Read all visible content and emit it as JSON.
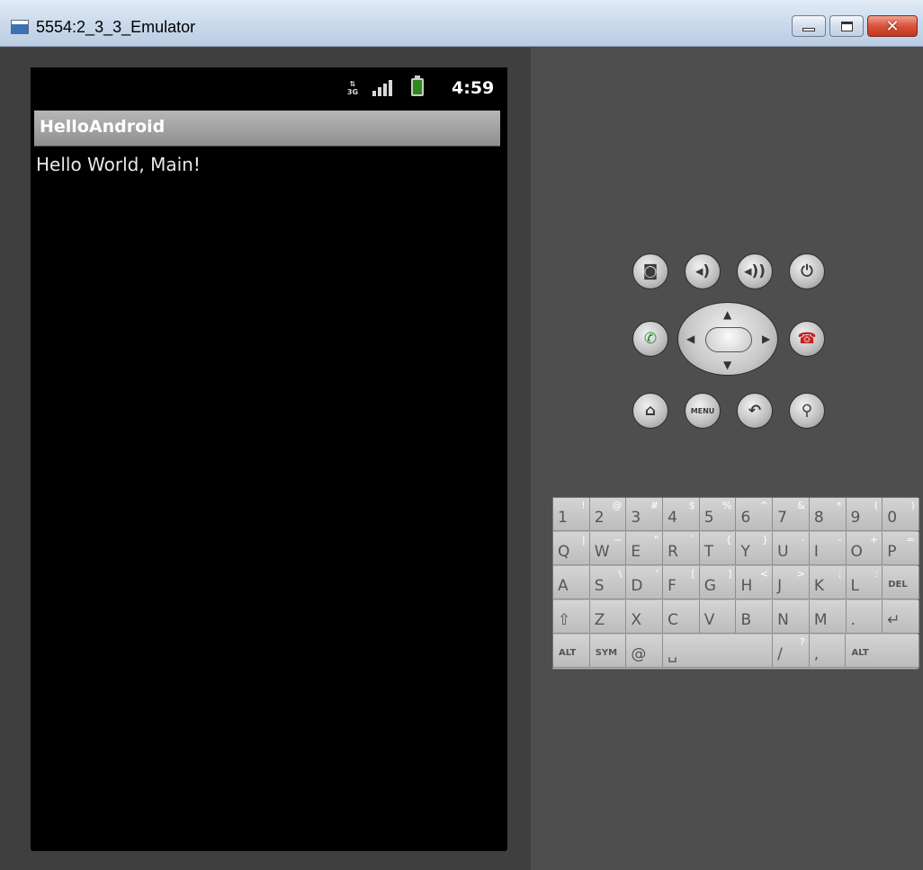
{
  "window": {
    "title": "5554:2_3_3_Emulator",
    "close_glyph": "✕"
  },
  "status_bar": {
    "network_label": "3G",
    "time": "4:59"
  },
  "app": {
    "title": "HelloAndroid",
    "message": "Hello World, Main!"
  },
  "controls": {
    "menu_label": "MENU"
  },
  "keyboard": {
    "row1": [
      {
        "main": "1",
        "alt": "!"
      },
      {
        "main": "2",
        "alt": "@"
      },
      {
        "main": "3",
        "alt": "#"
      },
      {
        "main": "4",
        "alt": "$"
      },
      {
        "main": "5",
        "alt": "%"
      },
      {
        "main": "6",
        "alt": "^"
      },
      {
        "main": "7",
        "alt": "&"
      },
      {
        "main": "8",
        "alt": "*"
      },
      {
        "main": "9",
        "alt": "("
      },
      {
        "main": "0",
        "alt": ")"
      }
    ],
    "row2": [
      {
        "main": "Q",
        "alt": "|"
      },
      {
        "main": "W",
        "alt": "~"
      },
      {
        "main": "E",
        "alt": "\""
      },
      {
        "main": "R",
        "alt": "`"
      },
      {
        "main": "T",
        "alt": "{"
      },
      {
        "main": "Y",
        "alt": "}"
      },
      {
        "main": "U",
        "alt": "-"
      },
      {
        "main": "I",
        "alt": "-"
      },
      {
        "main": "O",
        "alt": "+"
      },
      {
        "main": "P",
        "alt": "="
      }
    ],
    "row3": [
      {
        "main": "A",
        "alt": ""
      },
      {
        "main": "S",
        "alt": "\\"
      },
      {
        "main": "D",
        "alt": "'"
      },
      {
        "main": "F",
        "alt": "["
      },
      {
        "main": "G",
        "alt": "]"
      },
      {
        "main": "H",
        "alt": "<"
      },
      {
        "main": "J",
        "alt": ">"
      },
      {
        "main": "K",
        "alt": ";"
      },
      {
        "main": "L",
        "alt": ":"
      },
      {
        "main": "DEL",
        "alt": ""
      }
    ],
    "row4": [
      {
        "main": "⇧",
        "alt": ""
      },
      {
        "main": "Z",
        "alt": ""
      },
      {
        "main": "X",
        "alt": ""
      },
      {
        "main": "C",
        "alt": ""
      },
      {
        "main": "V",
        "alt": ""
      },
      {
        "main": "B",
        "alt": ""
      },
      {
        "main": "N",
        "alt": ""
      },
      {
        "main": "M",
        "alt": ""
      },
      {
        "main": ".",
        "alt": ""
      },
      {
        "main": "↵",
        "alt": ""
      }
    ],
    "row5": [
      {
        "main": "ALT",
        "alt": ""
      },
      {
        "main": "SYM",
        "alt": ""
      },
      {
        "main": "@",
        "alt": ""
      },
      {
        "main": "␣",
        "alt": ""
      },
      {
        "main": "/",
        "alt": "?"
      },
      {
        "main": ",",
        "alt": ""
      },
      {
        "main": "ALT",
        "alt": ""
      }
    ]
  }
}
